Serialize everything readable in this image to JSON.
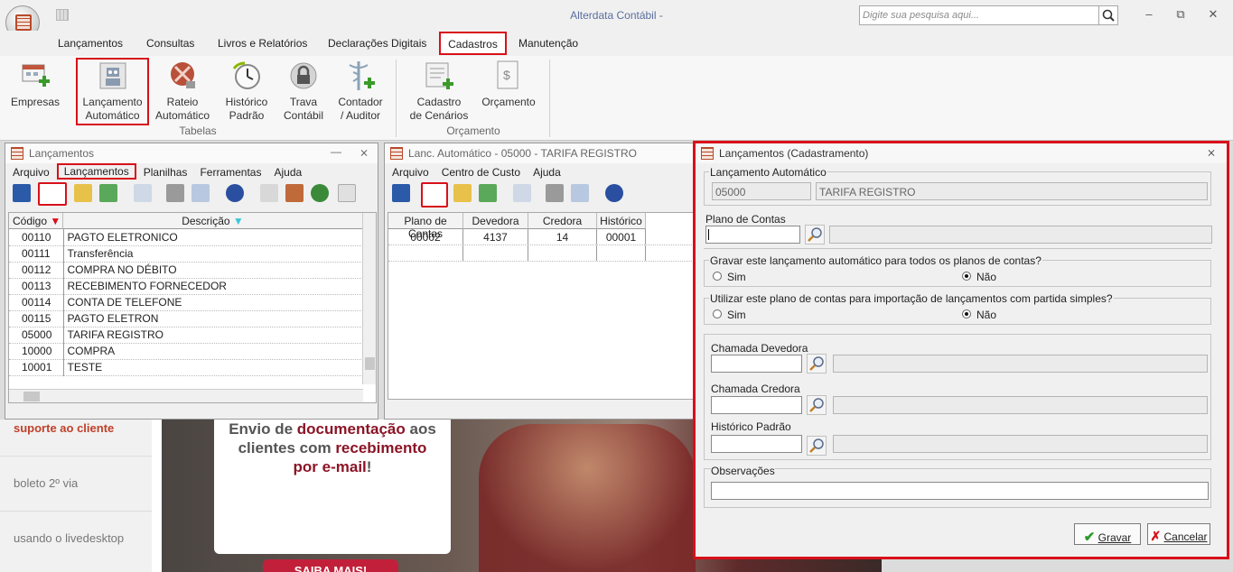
{
  "app": {
    "title": "Alterdata Contábil -",
    "search_placeholder": "Digite sua pesquisa aqui..."
  },
  "menu": {
    "tabs": [
      "Lançamentos",
      "Consultas",
      "Livros e Relatórios",
      "Declarações Digitais",
      "Cadastros",
      "Manutenção"
    ]
  },
  "ribbon": {
    "empresas": "Empresas",
    "lanc_auto_1": "Lançamento",
    "lanc_auto_2": "Automático",
    "rateio_1": "Rateio",
    "rateio_2": "Automático",
    "historico_1": "Histórico",
    "historico_2": "Padrão",
    "trava_1": "Trava",
    "trava_2": "Contábil",
    "contador_1": "Contador",
    "contador_2": "/ Auditor",
    "cenarios_1": "Cadastro",
    "cenarios_2": "de Cenários",
    "orcamento": "Orçamento",
    "group_tabelas": "Tabelas",
    "group_orcamento": "Orçamento"
  },
  "web": {
    "sidebar": [
      "suporte ao cliente",
      "boleto 2º via",
      "usando o livedesktop"
    ],
    "promo_1": "Envio de ",
    "promo_2": "documentação",
    "promo_3": " aos",
    "promo_4": "clientes com ",
    "promo_5": "recebimento",
    "promo_6": "por e-mail",
    "promo_7": "!",
    "cta": "SAIBA MAIS!"
  },
  "win_lanc": {
    "title": "Lançamentos",
    "menu": [
      "Arquivo",
      "Lançamentos",
      "Planilhas",
      "Ferramentas",
      "Ajuda"
    ],
    "col_codigo": "Código",
    "col_descricao": "Descrição",
    "rows": [
      {
        "codigo": "00110",
        "descricao": "PAGTO ELETRONICO"
      },
      {
        "codigo": "00111",
        "descricao": "Transferência"
      },
      {
        "codigo": "00112",
        "descricao": "COMPRA NO DÉBITO"
      },
      {
        "codigo": "00113",
        "descricao": "RECEBIMENTO FORNECEDOR"
      },
      {
        "codigo": "00114",
        "descricao": "CONTA DE TELEFONE"
      },
      {
        "codigo": "00115",
        "descricao": "PAGTO ELETRON"
      },
      {
        "codigo": "05000",
        "descricao": "TARIFA REGISTRO"
      },
      {
        "codigo": "10000",
        "descricao": "COMPRA"
      },
      {
        "codigo": "10001",
        "descricao": "TESTE"
      }
    ]
  },
  "win_auto": {
    "title": "Lanc. Automático - 05000 - TARIFA REGISTRO",
    "menu": [
      "Arquivo",
      "Centro de Custo",
      "Ajuda"
    ],
    "cols": [
      "Plano de Contas",
      "Devedora",
      "Credora",
      "Histórico"
    ],
    "row": {
      "plano": "00002",
      "devedora": "4137",
      "credora": "14",
      "historico": "00001"
    }
  },
  "dialog": {
    "title": "Lançamentos (Cadastramento)",
    "grp_lanc_auto": "Lançamento Automático",
    "codigo": "05000",
    "descricao": "TARIFA REGISTRO",
    "plano_contas": "Plano de Contas",
    "q1": "Gravar este lançamento automático para todos os planos de contas?",
    "q2": "Utilizar este plano de contas para importação de lançamentos com partida simples?",
    "sim": "Sim",
    "nao": "Não",
    "chamada_devedora": "Chamada Devedora",
    "chamada_credora": "Chamada Credora",
    "historico_padrao": "Histórico Padrão",
    "observacoes": "Observações",
    "gravar": "Gravar",
    "cancelar": "Cancelar"
  },
  "colors": {
    "highlight": "#d8101a",
    "brand": "#b84a2a",
    "promo_accent": "#8b1426"
  }
}
